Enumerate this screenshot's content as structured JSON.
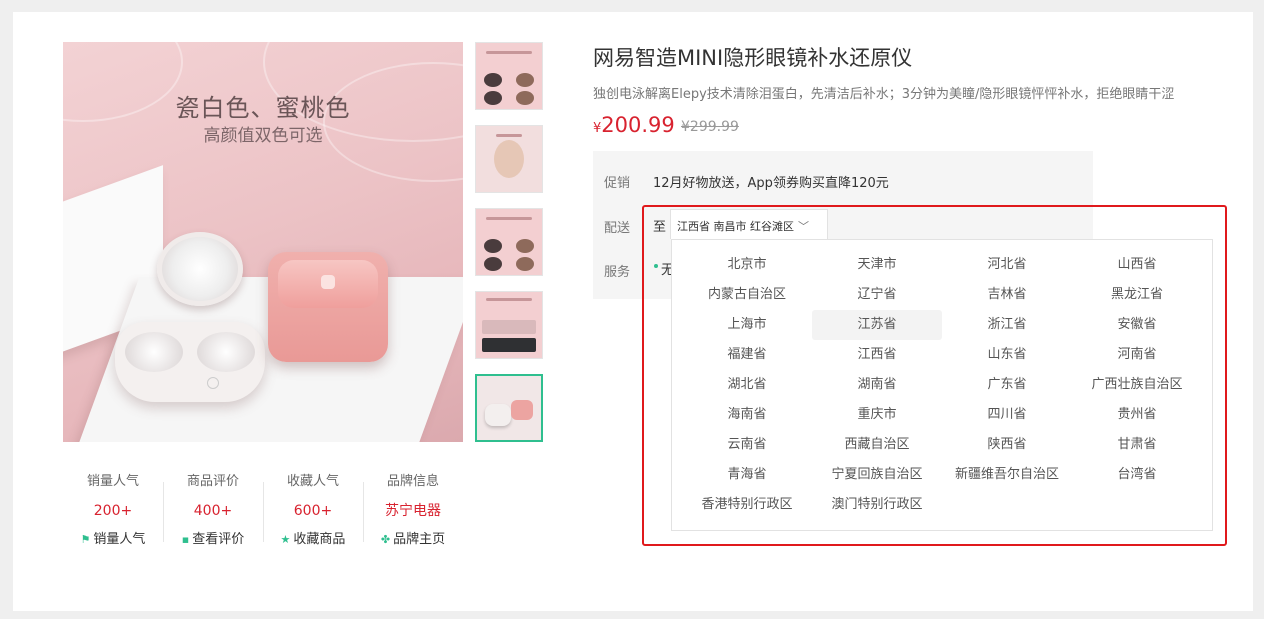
{
  "product": {
    "title": "网易智造MINI隐形眼镜补水还原仪",
    "description": "独创电泳解离Elepy技术清除泪蛋白，先清洁后补水；3分钟为美瞳/隐形眼镜怦怦补水，拒绝眼睛干涩",
    "currency": "¥",
    "price": "200.99",
    "original_price": "¥299.99",
    "image_title": "瓷白色、蜜桃色",
    "image_subtitle": "高颜值双色可选"
  },
  "thumbnails": [
    {
      "name": "thumb-1",
      "active": false
    },
    {
      "name": "thumb-2",
      "active": false
    },
    {
      "name": "thumb-3",
      "active": false
    },
    {
      "name": "thumb-4",
      "active": false
    },
    {
      "name": "thumb-5",
      "active": true
    }
  ],
  "stats": [
    {
      "label": "销量人气",
      "value": "200+",
      "link": "销量人气",
      "icon": "flag-icon",
      "glyph": "⚑"
    },
    {
      "label": "商品评价",
      "value": "400+",
      "link": "查看评价",
      "icon": "comment-icon",
      "glyph": "▪"
    },
    {
      "label": "收藏人气",
      "value": "600+",
      "link": "收藏商品",
      "icon": "star-icon",
      "glyph": "★"
    },
    {
      "label": "品牌信息",
      "value": "苏宁电器",
      "link": "品牌主页",
      "icon": "brand-icon",
      "glyph": "✤"
    }
  ],
  "info": {
    "promo_label": "促销",
    "promo_text": "12月好物放送，App领券购买直降120元",
    "delivery_label": "配送",
    "delivery_to": "至",
    "address": "江西省 南昌市 红谷滩区",
    "service_label": "服务",
    "service_text": "无"
  },
  "provinces": [
    "北京市",
    "天津市",
    "河北省",
    "山西省",
    "内蒙古自治区",
    "辽宁省",
    "吉林省",
    "黑龙江省",
    "上海市",
    "江苏省",
    "浙江省",
    "安徽省",
    "福建省",
    "江西省",
    "山东省",
    "河南省",
    "湖北省",
    "湖南省",
    "广东省",
    "广西壮族自治区",
    "海南省",
    "重庆市",
    "四川省",
    "贵州省",
    "云南省",
    "西藏自治区",
    "陕西省",
    "甘肃省",
    "青海省",
    "宁夏回族自治区",
    "新疆维吾尔自治区",
    "台湾省",
    "香港特别行政区",
    "澳门特别行政区"
  ],
  "highlighted_province": "江苏省",
  "colors": {
    "price_red": "#d8222f",
    "accent_green": "#2fbf8f",
    "highlight_border": "#e0191c"
  }
}
